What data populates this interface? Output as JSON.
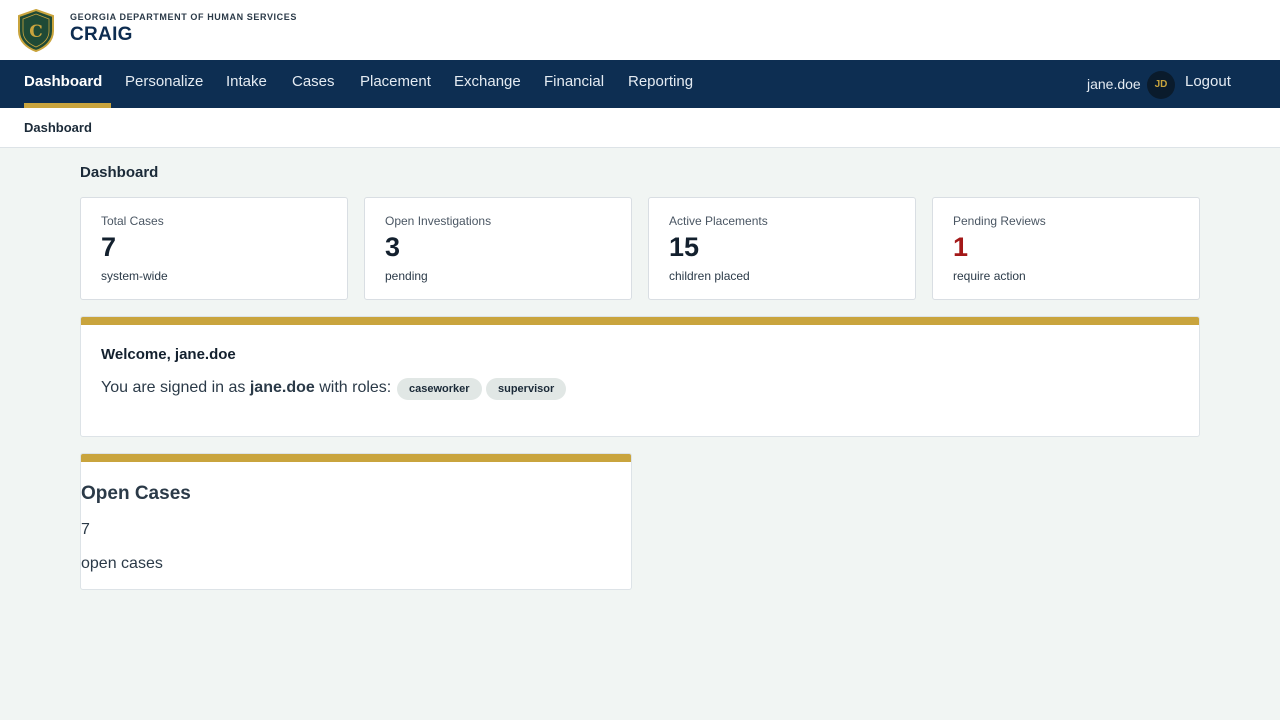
{
  "header": {
    "agency": "GEORGIA DEPARTMENT OF HUMAN SERVICES",
    "app_name": "CRAIG",
    "logo_letter": "C"
  },
  "nav": {
    "items": [
      {
        "label": "Dashboard",
        "active": true
      },
      {
        "label": "Personalize"
      },
      {
        "label": "Intake"
      },
      {
        "label": "Cases"
      },
      {
        "label": "Placement"
      },
      {
        "label": "Exchange"
      },
      {
        "label": "Financial"
      },
      {
        "label": "Reporting"
      }
    ],
    "user": "jane.doe",
    "avatar_initials": "JD",
    "logout_label": "Logout"
  },
  "breadcrumb": {
    "current": "Dashboard"
  },
  "page": {
    "title": "Dashboard"
  },
  "stats": [
    {
      "label": "Total Cases",
      "value": "7",
      "sub": "system-wide"
    },
    {
      "label": "Open Investigations",
      "value": "3",
      "sub": "pending"
    },
    {
      "label": "Active Placements",
      "value": "15",
      "sub": "children placed"
    },
    {
      "label": "Pending Reviews",
      "value": "1",
      "sub": "require action",
      "value_color": "#a31818"
    }
  ],
  "welcome": {
    "title": "Welcome, jane.doe",
    "prefix": "You are signed in as",
    "username": "jane.doe",
    "suffix": "with roles:",
    "roles": [
      "caseworker",
      "supervisor"
    ]
  },
  "open_cases": {
    "title": "Open Cases",
    "count": "7",
    "sub": "open cases"
  },
  "colors": {
    "navy": "#0d2e52",
    "gold": "#c9a43d",
    "alert_red": "#a31818",
    "page_bg": "#f1f5f3"
  }
}
